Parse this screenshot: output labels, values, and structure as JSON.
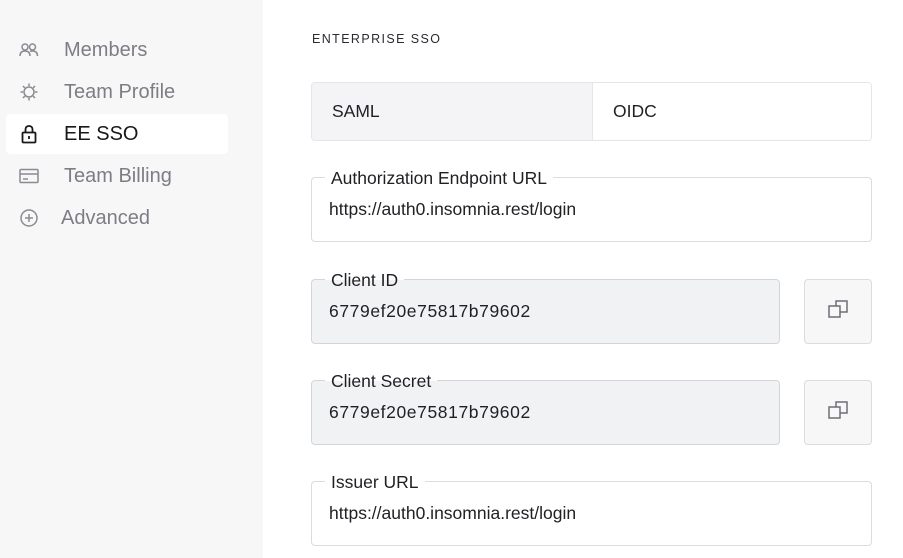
{
  "sidebar": {
    "items": [
      {
        "label": "Members",
        "icon": "members-icon",
        "active": false
      },
      {
        "label": "Team Profile",
        "icon": "gear-icon",
        "active": false
      },
      {
        "label": "EE SSO",
        "icon": "lock-icon",
        "active": true
      },
      {
        "label": "Team Billing",
        "icon": "credit-card-icon",
        "active": false
      },
      {
        "label": "Advanced",
        "icon": "plus-circle-icon",
        "active": false
      }
    ]
  },
  "main": {
    "section_title": "ENTERPRISE SSO",
    "tabs": [
      {
        "label": "SAML",
        "selected": false
      },
      {
        "label": "OIDC",
        "selected": true
      }
    ],
    "fields": {
      "auth_endpoint": {
        "label": "Authorization Endpoint URL",
        "value": "https://auth0.insomnia.rest/login"
      },
      "client_id": {
        "label": "Client ID",
        "value": "6779ef20e75817b79602"
      },
      "client_secret": {
        "label": "Client Secret",
        "value": "6779ef20e75817b79602"
      },
      "issuer_url": {
        "label": "Issuer URL",
        "value": "https://auth0.insomnia.rest/login"
      }
    }
  },
  "colors": {
    "sidebar_bg": "#f7f7f8",
    "active_item_bg": "#ffffff",
    "readonly_field_bg": "#f1f2f4",
    "muted_text": "#7d7d85"
  }
}
